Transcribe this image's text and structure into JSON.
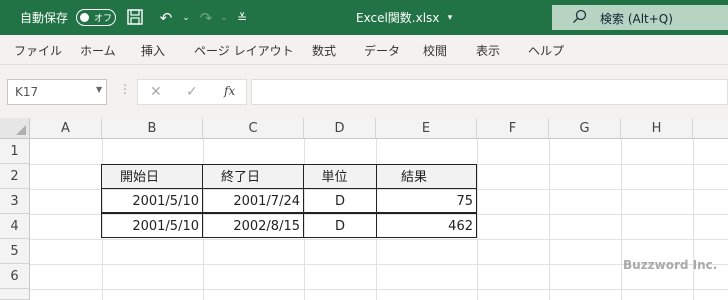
{
  "titlebar": {
    "autosave_label": "自動保存",
    "autosave_state": "オフ",
    "doc_title": "Excel関数.xlsx",
    "search_label": "検索 (Alt+Q)",
    "accent": "#217346"
  },
  "ribbon": {
    "tabs": [
      "ファイル",
      "ホーム",
      "挿入",
      "ページ レイアウト",
      "数式",
      "データ",
      "校閲",
      "表示",
      "ヘルプ"
    ]
  },
  "formula_bar": {
    "name_box": "K17",
    "fx": "fx",
    "formula": ""
  },
  "sheet": {
    "columns": [
      "A",
      "B",
      "C",
      "D",
      "E",
      "F",
      "G",
      "H"
    ],
    "rows": [
      "1",
      "2",
      "3",
      "4",
      "5",
      "6"
    ],
    "table": {
      "headers": [
        "開始日",
        "終了日",
        "単位",
        "結果"
      ],
      "rows": [
        [
          "2001/5/10",
          "2001/7/24",
          "D",
          "75"
        ],
        [
          "2001/5/10",
          "2002/8/15",
          "D",
          "462"
        ]
      ]
    }
  },
  "watermark": "Buzzword Inc."
}
